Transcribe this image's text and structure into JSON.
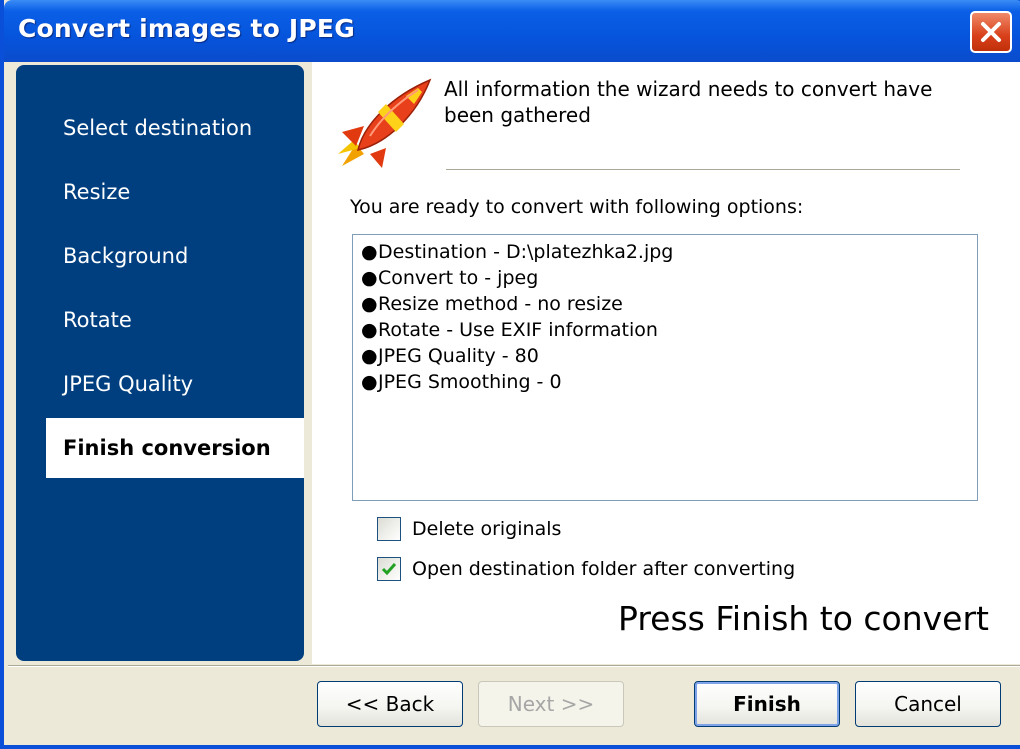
{
  "window": {
    "title": "Convert images to JPEG",
    "close_icon": "close-icon"
  },
  "nav": {
    "items": [
      {
        "label": "Select destination",
        "active": false
      },
      {
        "label": "Resize",
        "active": false
      },
      {
        "label": "Background",
        "active": false
      },
      {
        "label": "Rotate",
        "active": false
      },
      {
        "label": "JPEG Quality",
        "active": false
      },
      {
        "label": "Finish conversion",
        "active": true
      }
    ]
  },
  "content": {
    "icon": "rocket-icon",
    "intro": "All information the wizard needs to convert have been gathered",
    "ready_label": "You are ready to convert with following options:",
    "summary": [
      "Destination - D:\\platezhka2.jpg",
      "Convert to - jpeg",
      "Resize method - no resize",
      "Rotate - Use EXIF information",
      "JPEG Quality - 80",
      "JPEG Smoothing - 0"
    ],
    "bullet": "●",
    "delete_originals": {
      "label": "Delete originals",
      "checked": false
    },
    "open_folder": {
      "label": "Open destination folder after converting",
      "checked": true
    },
    "press_finish": "Press Finish to convert"
  },
  "buttons": {
    "back": "<< Back",
    "next": "Next >>",
    "finish": "Finish",
    "cancel": "Cancel"
  },
  "colors": {
    "nav_background": "#003f7f",
    "titlebar": "#0654dc",
    "accent_close": "#d8401a"
  }
}
